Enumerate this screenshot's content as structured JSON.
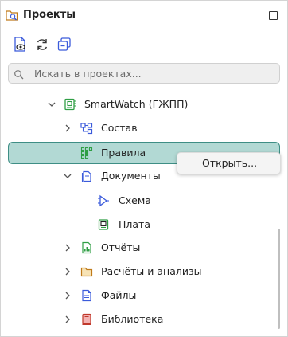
{
  "panel": {
    "title": "Проекты",
    "title_icon": "projects-search-icon",
    "maximize_icon": "maximize-icon"
  },
  "toolbar": {
    "buttons": [
      {
        "name": "show-project-button",
        "icon": "document-eye-icon"
      },
      {
        "name": "refresh-button",
        "icon": "refresh-icon"
      },
      {
        "name": "collapse-all-button",
        "icon": "collapse-all-icon"
      }
    ]
  },
  "search": {
    "placeholder": "Искать в проектах...",
    "value": ""
  },
  "tree": {
    "root": {
      "label": "SmartWatch (ГЖПП)",
      "icon": "board-project-icon",
      "expanded": true
    },
    "items": [
      {
        "label": "Состав",
        "icon": "structure-icon",
        "expanded": false
      },
      {
        "label": "Правила",
        "icon": "rules-grid-icon",
        "selected": true
      },
      {
        "label": "Документы",
        "icon": "documents-icon",
        "expanded": true
      },
      {
        "label": "Схема",
        "icon": "schematic-icon"
      },
      {
        "label": "Плата",
        "icon": "board-icon"
      },
      {
        "label": "Отчёты",
        "icon": "reports-icon",
        "expanded": false
      },
      {
        "label": "Расчёты и анализы",
        "icon": "folder-icon",
        "expanded": false
      },
      {
        "label": "Файлы",
        "icon": "file-icon",
        "expanded": false
      },
      {
        "label": "Библиотека",
        "icon": "library-icon",
        "expanded": false
      }
    ]
  },
  "context_menu": {
    "items": [
      {
        "label": "Открыть..."
      }
    ]
  },
  "colors": {
    "selection_bg": "#b2d9d4",
    "selection_border": "#3e8e85",
    "icon_blue": "#3b5bdb",
    "icon_green": "#2f9e44"
  }
}
